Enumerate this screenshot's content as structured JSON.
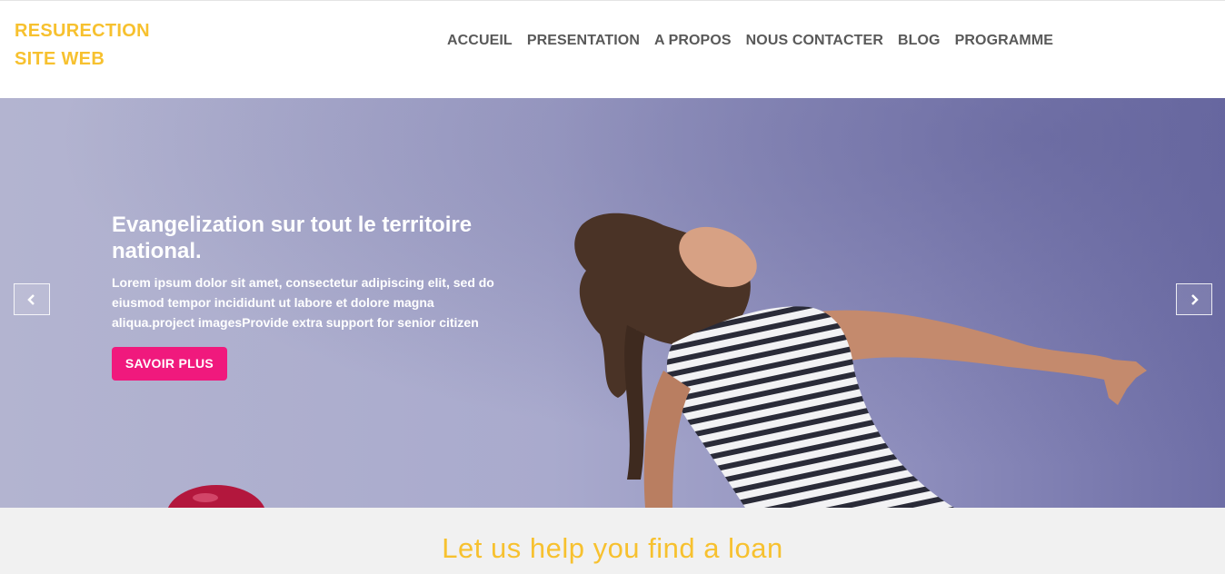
{
  "brand": {
    "line1": "RESURECTION",
    "line2": "SITE WEB"
  },
  "nav": [
    {
      "label": "ACCUEIL"
    },
    {
      "label": "PRESENTATION"
    },
    {
      "label": "A PROPOS"
    },
    {
      "label": "NOUS CONTACTER"
    },
    {
      "label": "BLOG"
    },
    {
      "label": "PROGRAMME"
    }
  ],
  "hero": {
    "title": "Evangelization sur tout le territoire national.",
    "description": "Lorem ipsum dolor sit amet, consectetur adipiscing elit, sed do eiusmod tempor incididunt ut labore et dolore magna aliqua.project imagesProvide extra support for senior citizen",
    "button_label": "SAVOIR PLUS",
    "prev_icon": "chevron-left-icon",
    "next_icon": "chevron-right-icon"
  },
  "section": {
    "title": "Let us help you find a loan"
  },
  "colors": {
    "brand": "#f7c12f",
    "nav_text": "#595959",
    "button": "#f0197d",
    "section_bg": "#f1f1f1"
  }
}
